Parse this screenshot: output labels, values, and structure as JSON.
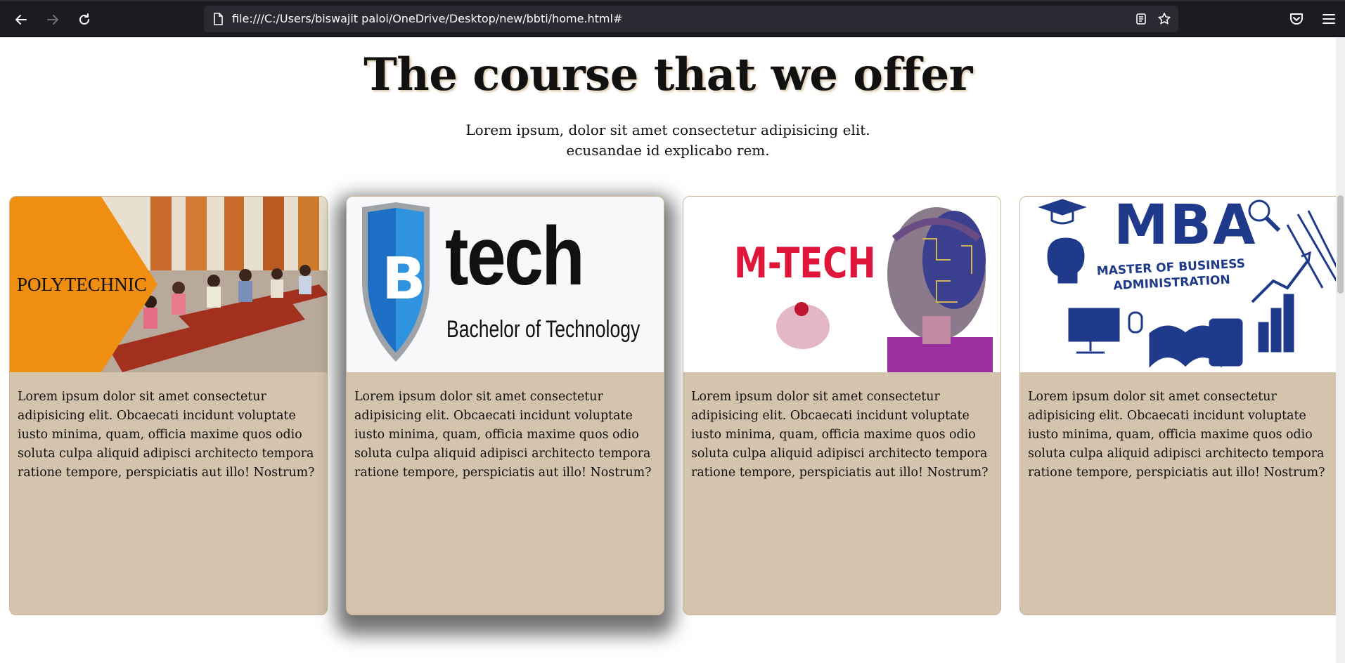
{
  "browser": {
    "url": "file:///C:/Users/biswajit paloi/OneDrive/Desktop/new/bbti/home.html#"
  },
  "section": {
    "title": "The course that we offer",
    "subtitle_line1": "Lorem ipsum, dolor sit amet consectetur adipisicing elit.",
    "subtitle_line2": "ecusandae id explicabo rem."
  },
  "cards": [
    {
      "image_text": "POLYTECHNIC",
      "description": "Lorem ipsum dolor sit amet consectetur adipisicing elit. Obcaecati incidunt voluptate iusto minima, quam, officia maxime quos odio soluta culpa aliquid adipisci architecto tempora ratione tempore, perspiciatis aut illo! Nostrum?"
    },
    {
      "image_text": "tech",
      "image_text_initial": "B",
      "image_subtext": "Bachelor of Technology",
      "description": "Lorem ipsum dolor sit amet consectetur adipisicing elit. Obcaecati incidunt voluptate iusto minima, quam, officia maxime quos odio soluta culpa aliquid adipisci architecto tempora ratione tempore, perspiciatis aut illo! Nostrum?"
    },
    {
      "image_text": "M-TECH",
      "description": "Lorem ipsum dolor sit amet consectetur adipisicing elit. Obcaecati incidunt voluptate iusto minima, quam, officia maxime quos odio soluta culpa aliquid adipisci architecto tempora ratione tempore, perspiciatis aut illo! Nostrum?"
    },
    {
      "image_text": "MBA",
      "image_subtext_line1": "MASTER OF BUSINESS",
      "image_subtext_line2": "ADMINISTRATION",
      "description": "Lorem ipsum dolor sit amet consectetur adipisicing elit. Obcaecati incidunt voluptate iusto minima, quam, officia maxime quos odio soluta culpa aliquid adipisci architecto tempora ratione tempore, perspiciatis aut illo! Nostrum?"
    }
  ],
  "colors": {
    "card_bg": "#d4c3ad",
    "chrome_bg": "#1c1b22",
    "urlbar_bg": "#2b2a33",
    "poly_orange": "#ef8e11",
    "mtech_red": "#e0153a",
    "mba_blue": "#1f3a8a"
  }
}
